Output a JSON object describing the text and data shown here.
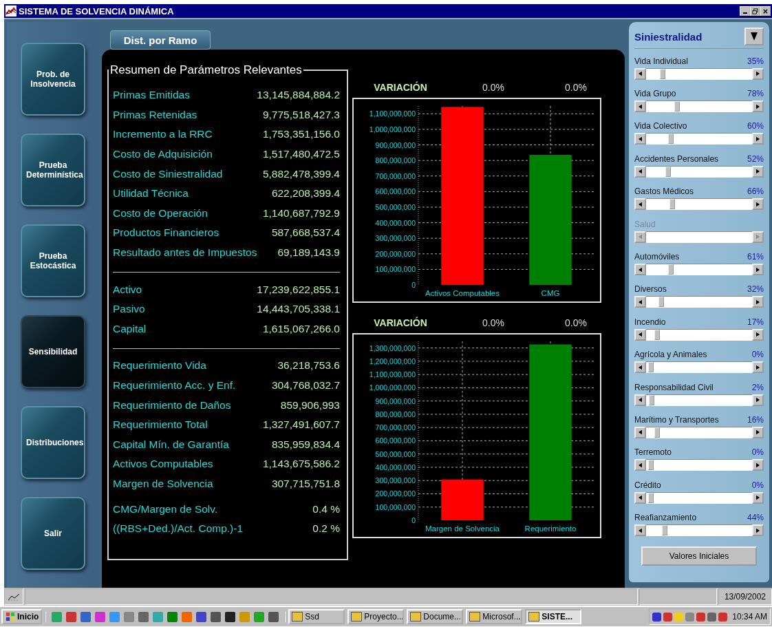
{
  "window": {
    "title": "SISTEMA DE SOLVENCIA DINÁMICA"
  },
  "nav": [
    {
      "label": "Prob. de Insolvencia",
      "selected": false
    },
    {
      "label": "Prueba Determinística",
      "selected": false
    },
    {
      "label": "Prueba Estocástica",
      "selected": false
    },
    {
      "label": "Sensibilidad",
      "selected": true
    },
    {
      "label": "Distribuciones",
      "selected": false
    },
    {
      "label": "Salir",
      "selected": false
    }
  ],
  "dist_button": "Dist. por Ramo",
  "summary": {
    "title": "Resumen de Parámetros Relevantes",
    "groups": [
      {
        "rule_before": false,
        "rows": [
          [
            "Primas Emitidas",
            "13,145,884,884.2"
          ],
          [
            "Primas Retenidas",
            "9,775,518,427.3"
          ],
          [
            "Incremento a la RRC",
            "1,753,351,156.0"
          ],
          [
            "Costo de Adquisición",
            "1,517,480,472.5"
          ],
          [
            "Costo de Siniestralidad",
            "5,882,478,399.4"
          ],
          [
            "Utilidad Técnica",
            "622,208,399.4"
          ],
          [
            "Costo de Operación",
            "1,140,687,792.9"
          ],
          [
            "Productos Financieros",
            "587,668,537.4"
          ],
          [
            "Resultado antes de Impuestos",
            "69,189,143.9"
          ]
        ]
      },
      {
        "rule_before": true,
        "rows": [
          [
            "Activo",
            "17,239,622,855.1"
          ],
          [
            "Pasivo",
            "14,443,705,338.1"
          ],
          [
            "Capital",
            "1,615,067,266.0"
          ]
        ]
      },
      {
        "rule_before": true,
        "rows": [
          [
            "Requerimiento Vida",
            "36,218,753.6"
          ],
          [
            "Requerimiento Acc. y Enf.",
            "304,768,032.7"
          ],
          [
            "Requerimiento de Daños",
            "859,906,993"
          ],
          [
            "Requerimiento Total",
            "1,327,491,607.7"
          ],
          [
            "Capital Mín. de Garantía",
            "835,959,834.4"
          ],
          [
            "Activos Computables",
            "1,143,675,586.2"
          ],
          [
            "Margen de Solvencia",
            "307,715,751.8"
          ]
        ]
      },
      {
        "rule_before": false,
        "rows": [
          [
            "CMG/Margen de Solv.",
            "0.4 %"
          ],
          [
            "((RBS+Ded.)/Act. Comp.)-1",
            "0.2 %"
          ]
        ]
      }
    ]
  },
  "charts": [
    {
      "header": "VARIACIÓN",
      "variations": [
        "0.0%",
        "0.0%"
      ],
      "chart_data": {
        "type": "bar",
        "categories": [
          "Activos Computables",
          "CMG"
        ],
        "stacked": true,
        "grid": true,
        "series": [
          {
            "color": "#ff0000",
            "values": [
              1144000000,
              null
            ]
          },
          {
            "color": "#008000",
            "values": [
              null,
              836000000
            ]
          }
        ],
        "ylim": [
          0,
          1150000000
        ],
        "yticks": [
          {
            "value": 0,
            "label": "0"
          },
          {
            "value": 100000000,
            "label": "100,000,000"
          },
          {
            "value": 200000000,
            "label": "200,000,000"
          },
          {
            "value": 300000000,
            "label": "300,000,000"
          },
          {
            "value": 400000000,
            "label": "400,000,000"
          },
          {
            "value": 500000000,
            "label": "500,000,000"
          },
          {
            "value": 600000000,
            "label": "600,000,000"
          },
          {
            "value": 700000000,
            "label": "700,000,000"
          },
          {
            "value": 800000000,
            "label": "800,000,000"
          },
          {
            "value": 900000000,
            "label": "900,000,000"
          },
          {
            "value": 1000000000,
            "label": "1,000,000,000"
          },
          {
            "value": 1100000000,
            "label": "1,100,000,000"
          }
        ]
      }
    },
    {
      "header": "VARIACIÓN",
      "variations": [
        "0.0%",
        "0.0%"
      ],
      "chart_data": {
        "type": "bar",
        "categories": [
          "Margen de Solvencia",
          "Requerimiento"
        ],
        "stacked": true,
        "grid": true,
        "series": [
          {
            "color": "#ff0000",
            "values": [
              308000000,
              null
            ]
          },
          {
            "color": "#008000",
            "values": [
              null,
              1327000000
            ]
          }
        ],
        "ylim": [
          0,
          1350000000
        ],
        "yticks": [
          {
            "value": 0,
            "label": "0"
          },
          {
            "value": 100000000,
            "label": "100,000,000"
          },
          {
            "value": 200000000,
            "label": "200,000,000"
          },
          {
            "value": 300000000,
            "label": "300,000,000"
          },
          {
            "value": 400000000,
            "label": "400,000,000"
          },
          {
            "value": 500000000,
            "label": "500,000,000"
          },
          {
            "value": 600000000,
            "label": "600,000,000"
          },
          {
            "value": 700000000,
            "label": "700,000,000"
          },
          {
            "value": 800000000,
            "label": "800,000,000"
          },
          {
            "value": 900000000,
            "label": "900,000,000"
          },
          {
            "value": 1000000000,
            "label": "1,000,000,000"
          },
          {
            "value": 1100000000,
            "label": "1,100,000,000"
          },
          {
            "value": 1200000000,
            "label": "1,200,000,000"
          },
          {
            "value": 1300000000,
            "label": "1,300,000,000"
          }
        ]
      }
    }
  ],
  "panel": {
    "title": "Siniestralidad",
    "sliders": [
      {
        "label": "Vida Individual",
        "reading": "35%",
        "level": 0.14,
        "disabled": false
      },
      {
        "label": "Vida Grupo",
        "reading": "78%",
        "level": 0.28,
        "disabled": false
      },
      {
        "label": "Vida Colectivo",
        "reading": "60%",
        "level": 0.22,
        "disabled": false
      },
      {
        "label": "Accidentes Personales",
        "reading": "52%",
        "level": 0.19,
        "disabled": false
      },
      {
        "label": "Gastos Médicos",
        "reading": "66%",
        "level": 0.23,
        "disabled": false
      },
      {
        "label": "Salud",
        "disabled": true
      },
      {
        "label": "Automóviles",
        "reading": "61%",
        "level": 0.22,
        "disabled": false
      },
      {
        "label": "Diversos",
        "reading": "32%",
        "level": 0.12,
        "disabled": false
      },
      {
        "label": "Incendio",
        "reading": "17%",
        "level": 0.08,
        "disabled": false
      },
      {
        "label": "Agrícola y Animales",
        "reading": "0%",
        "level": 0.02,
        "disabled": false
      },
      {
        "label": "Responsabilidad Civil",
        "reading": "2%",
        "level": 0.03,
        "disabled": false
      },
      {
        "label": "Marítimo y Transportes",
        "reading": "16%",
        "level": 0.08,
        "disabled": false
      },
      {
        "label": "Terremoto",
        "reading": "0%",
        "level": 0.02,
        "disabled": false
      },
      {
        "label": "Crédito",
        "reading": "0%",
        "level": 0.02,
        "disabled": false
      },
      {
        "label": "Reafianzamiento",
        "reading": "44%",
        "level": 0.16,
        "disabled": false
      }
    ],
    "reset_button": "Valores Iniciales"
  },
  "status_bar": {
    "date": "13/09/2002"
  },
  "taskbar": {
    "start": "Inicio",
    "tasks": [
      {
        "label": "Ssd",
        "selected": false
      },
      {
        "label": "Proyecto...",
        "selected": false
      },
      {
        "label": "Docume...",
        "selected": false
      },
      {
        "label": "Microsof...",
        "selected": false
      },
      {
        "label": "SISTE...",
        "selected": true
      }
    ],
    "clock": "10:34 AM"
  }
}
